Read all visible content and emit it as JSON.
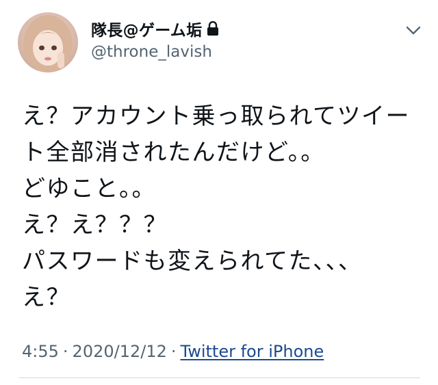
{
  "user": {
    "display_name": "隊長@ゲーム垢",
    "handle": "@throne_lavish",
    "protected_icon": "lock-icon",
    "avatar_icon": "profile-photo"
  },
  "menu": {
    "icon": "chevron-down-icon"
  },
  "tweet": {
    "lines": [
      "え？アカウント乗っ取られてツイー",
      "ト全部消されたんだけど。。",
      "どゆこと。。",
      "え？え？？？",
      "パスワードも変えられてた、、、",
      "え？"
    ]
  },
  "meta": {
    "time": "4:55",
    "separator": "·",
    "date": "2020/12/12",
    "source": "Twitter for iPhone"
  },
  "colors": {
    "text": "#0f1419",
    "secondary": "#536471",
    "link": "#1b4a8f",
    "divider": "#cfd9de"
  }
}
